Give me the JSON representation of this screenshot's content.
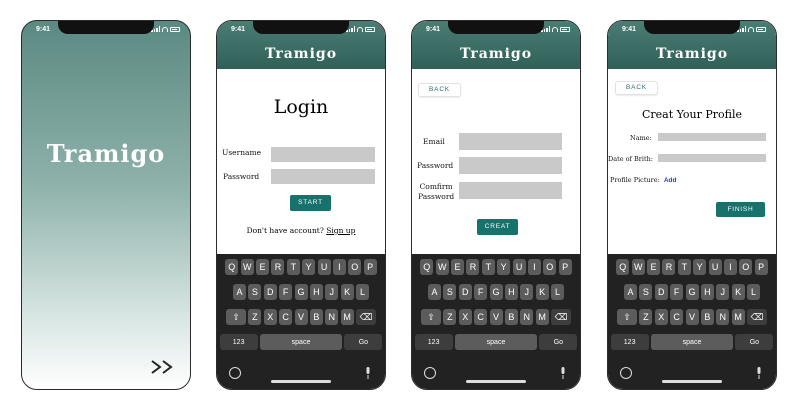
{
  "status": {
    "time": "9:41"
  },
  "splash": {
    "logo": "Tramigo"
  },
  "app_title": "Tramigo",
  "login": {
    "title": "Login",
    "username_label": "Username",
    "password_label": "Password",
    "start_button": "START",
    "no_account_text": "Don't have account?",
    "sign_up_link": "Sign up"
  },
  "signup": {
    "back_button": "BACK",
    "email_label": "Email",
    "password_label": "Password",
    "confirm_label_line1": "Comfirm",
    "confirm_label_line2": "Password",
    "create_button": "CREAT"
  },
  "profile": {
    "back_button": "BACK",
    "title": "Creat Your Profile",
    "name_label": "Name:",
    "dob_label": "Date of Brith:",
    "picture_label": "Profile Picture:",
    "add_link": "Add",
    "finish_button": "FINISH"
  },
  "keyboard": {
    "row1": [
      "Q",
      "W",
      "E",
      "R",
      "T",
      "Y",
      "U",
      "I",
      "O",
      "P"
    ],
    "row2": [
      "A",
      "S",
      "D",
      "F",
      "G",
      "H",
      "J",
      "K",
      "L"
    ],
    "row3": [
      "Z",
      "X",
      "C",
      "V",
      "B",
      "N",
      "M"
    ],
    "num_key": "123",
    "space_key": "space",
    "go_key": "Go"
  },
  "colors": {
    "primary": "#17726c",
    "header": "#3f7169",
    "field": "#c9c9c9",
    "link": "#1a3fd1"
  }
}
